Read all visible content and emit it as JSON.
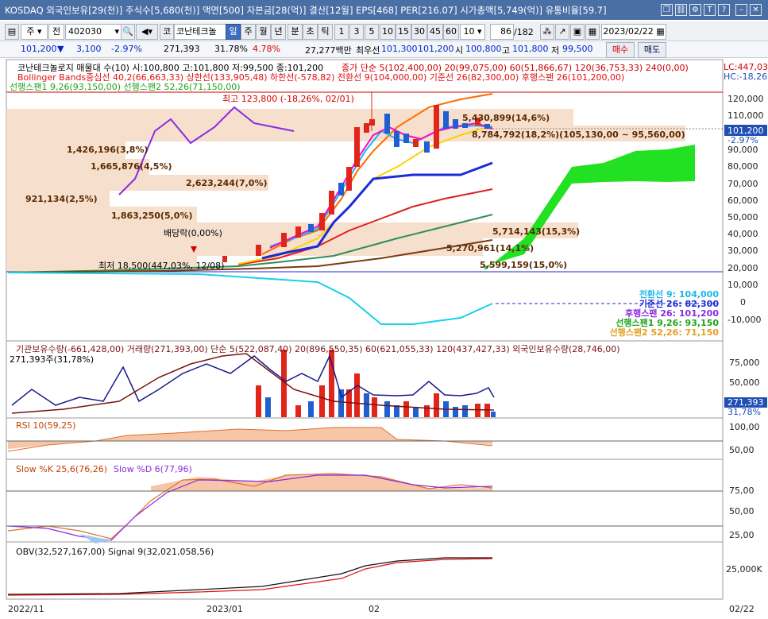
{
  "window": {
    "title": "KOSDAQ 외국인보유[29(천)] 주식수[5,680(천)] 액면[500] 자본금[28(억)] 결산[12월] EPS[468] PER[216.07] 시가총액[5,749(억)] 유통비율[59.7]"
  },
  "toolbar": {
    "mode": "주",
    "market": "전",
    "code": "402030",
    "name": "코난테크놀",
    "periods": [
      "일",
      "주",
      "월",
      "년",
      "분",
      "초",
      "틱"
    ],
    "periods_active": "일",
    "intervals": [
      "1",
      "3",
      "5",
      "10",
      "15",
      "30",
      "45",
      "60",
      "10"
    ],
    "count": "86",
    "total": "/182",
    "date": "2023/02/22",
    "buy": "매수",
    "sell": "매도"
  },
  "quote": {
    "price": "101,200",
    "change": "3,100",
    "pct": "-2.97%",
    "volume": "271,393",
    "turnover": "31.78%",
    "vol_ratio": "4.78%",
    "amount": "27,277백만",
    "best_ask_label": "최우선",
    "best_ask": "101,300",
    "best_bid": "101,200",
    "open_label": "시",
    "open": "100,800",
    "high_label": "고",
    "high": "101,800",
    "low_label": "저",
    "low": "99,500"
  },
  "price_panel": {
    "title_line": "코난테크놀로지 매물대 수(10)  시:100,800 고:101,800 저:99,500 종:101,200",
    "ma_line": "종가 단순 5(102,400,00)  20(99,075,00)  60(51,866,67)  120(36,753,33)  240(0,00)",
    "bb_line": "Bollinger Bands중심선 40,2(66,663,33)  상한선(133,905,48)  하한선(-578,82)  전환선 9(104,000,00)  기준선 26(82,300,00)  후행스팬 26(101,200,00)",
    "span_line": "선행스팬1 9,26(93,150,00)  선행스팬2 52,26(71,150,00)",
    "lc": "LC:447,03",
    "hc": "HC:-18,26",
    "price_tag": "101,200",
    "price_pct": "-2.97%",
    "high_note": "최고 123,800 (-18,26%, 02/01)",
    "low_note": "최저 18,500(447,03%, 12/08)",
    "dividend": "배당락(0,00%)",
    "y_ticks": [
      "120,000",
      "110,000",
      "100,000",
      "90,000",
      "80,000",
      "70,000",
      "60,000",
      "50,000",
      "40,000",
      "30,000",
      "20,000",
      "10,000",
      "0",
      "-10,000"
    ],
    "profile_labels": [
      "1,426,196(3,8%)",
      "1,665,876(4,5%)",
      "2,623,244(7,0%)",
      "921,134(2,5%)",
      "1,863,250(5,0%)",
      "5,430,899(14,6%)",
      "8,784,792(18,2%)(105,130,00 ~ 95,560,00)",
      "5,714,143(15,3%)",
      "5,270,961(14,1%)",
      "5,599,159(15,0%)"
    ],
    "ichimoku_labels": [
      "전환선  9: 104,000",
      "기준선  26: 82,300",
      "후행스팬  26: 101,200",
      "선행스팬1  9,26: 93,150",
      "선행스팬2  52,26: 71,150"
    ]
  },
  "volume_panel": {
    "legend": "기관보유수량(-661,428,00)  거래량(271,393,00)  단순 5(522,087,40)  20(896,550,35)  60(621,055,33)  120(437,427,33)  외국인보유수량(28,746,00)",
    "sub": "271,393주(31,78%)",
    "y_ticks": [
      "75,000",
      "50,000",
      "25,000"
    ],
    "tag": "271,393",
    "tag_pct": "31,78%"
  },
  "rsi_panel": {
    "legend": "RSI 10(59,25)",
    "y_ticks": [
      "100,00",
      "50,00"
    ]
  },
  "stoch_panel": {
    "legend_k": "Slow %K 25,6(76,26)",
    "legend_d": "Slow %D 6(77,96)",
    "y_ticks": [
      "75,00",
      "50,00",
      "25,00"
    ]
  },
  "obv_panel": {
    "legend": "OBV(32,527,167,00)  Signal 9(32,021,058,56)",
    "y_ticks": [
      "25,000K"
    ]
  },
  "x_axis": {
    "labels": [
      "2022/11",
      "2023/01",
      "02",
      "02/22"
    ]
  },
  "colors": {
    "up": "#e1251b",
    "down": "#1f5fd1",
    "cloud": "#22e022",
    "ma5": "#ff00cc",
    "ma20": "#ffd000",
    "ma60": "#2f8f5a",
    "ma120": "#7a3b10",
    "tenkan": "#19b8e8",
    "kijun": "#1b2bd8"
  }
}
